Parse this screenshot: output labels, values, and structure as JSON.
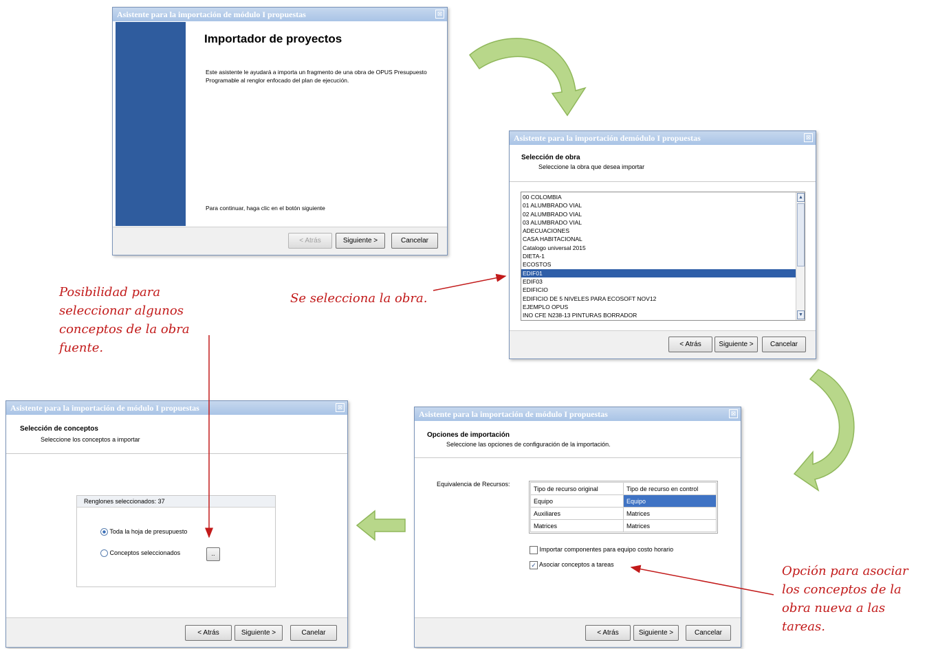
{
  "wizard_title": "Asistente para la importación de módulo I propuestas",
  "wizard_title_2": "Asistente para la importación demódulo I propuestas",
  "close_glyph": "⊠",
  "welcome": {
    "heading": "Importador de proyectos",
    "description": "Este asistente le ayudará a importa un fragmento de  una obra de OPUS Presupuesto Programable al renglor enfocado del plan de ejecución.",
    "continue_text": "Para continuar, haga clic en el botón siguiente"
  },
  "buttons": {
    "back": "< Atrás",
    "next": "Siguiente >",
    "cancel": "Cancelar",
    "cancel_alt": "Canelar",
    "dots": ".."
  },
  "obra": {
    "title": "Selección de obra",
    "subtitle": "Seleccione la obra que desea importar",
    "items": [
      "00 COLOMBIA",
      "01 ALUMBRADO VIAL",
      "02 ALUMBRADO VIAL",
      "03 ALUMBRADO VIAL",
      "ADECUACIONES",
      "CASA HABITACIONAL",
      "Catalogo universal 2015",
      "DIETA-1",
      "ECOSTOS",
      "EDIF01",
      "EDIF03",
      "EDIFICIO",
      "EDIFICIO DE 5 NIVELES PARA ECOSOFT NOV12",
      "EJEMPLO OPUS",
      "INO CFE N238-13 PINTURAS BORRADOR"
    ],
    "selected": "EDIF01"
  },
  "conceptos": {
    "title": "Selección de conceptos",
    "subtitle": "Seleccione los conceptos a importar",
    "group_label": "Renglones seleccionados: 37",
    "option1": "Toda la hoja de presupuesto",
    "option2": "Conceptos seleccionados"
  },
  "opciones": {
    "title": "Opciones de importación",
    "subtitle": "Seleccione las opciones de configuración de la importación.",
    "equiv_label": "Equivalencia de Recursos:",
    "col1": "Tipo de recurso original",
    "col2": "Tipo de recurso en control",
    "rows": [
      [
        "Equipo",
        "Equipo"
      ],
      [
        "Auxiliares",
        "Matrices"
      ],
      [
        "Matrices",
        "Matrices"
      ]
    ],
    "check1": "Importar componentes para equipo costo horario",
    "check2": "Asociar conceptos a tareas",
    "check1_checked": false,
    "check2_checked": true
  },
  "notes": {
    "select_obra": "Se selecciona la obra.",
    "possibility": [
      "Posibilidad para",
      "seleccionar algunos",
      "conceptos de la obra",
      "fuente."
    ],
    "option": [
      "Opción para asociar",
      "los conceptos de la",
      "obra nueva a las",
      "tareas."
    ]
  },
  "colors": {
    "annotation": "#c21a1a",
    "banner": "#2f5c9e",
    "selection": "#2e5ea8",
    "arrow_green": "#b8d78a"
  }
}
